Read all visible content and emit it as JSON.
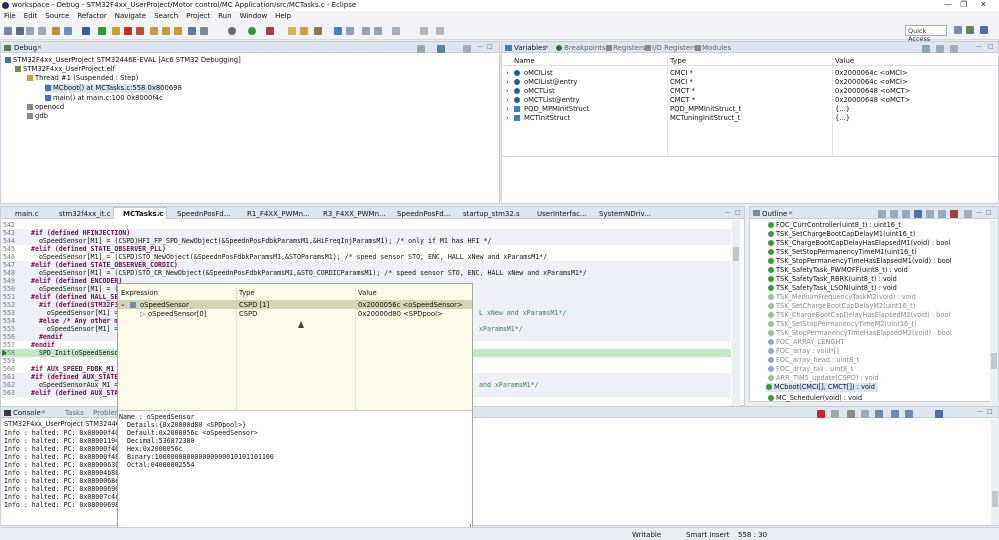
{
  "window": {
    "title": "workspace - Debug - STM32F4xx_UserProject/Motor control/MC Application/src/MCTasks.c - Eclipse"
  },
  "menu": [
    "File",
    "Edit",
    "Source",
    "Refactor",
    "Navigate",
    "Search",
    "Project",
    "Run",
    "Window",
    "Help"
  ],
  "quick_access": "Quick Access",
  "debug": {
    "tab": "Debug",
    "tree": [
      "STM32F4xx_UserProject STM32446E-EVAL [Ac6 STM32 Debugging]",
      "STM32F4xx_UserProject.elf",
      "Thread #1 (Suspended : Step)",
      "MCboot() at MCTasks.c:558 0x800698",
      "main() at main.c:100 0x8000f4c",
      "openocd",
      "gdb"
    ]
  },
  "variables": {
    "tabs": [
      "Variables",
      "Breakpoints",
      "Registers",
      "I/O Registers",
      "Modules"
    ],
    "columns": [
      "Name",
      "Type",
      "Value"
    ],
    "rows": [
      {
        "name": "oMCIList",
        "type": "CMCI *",
        "value": "0x2000064c <oMCI>"
      },
      {
        "name": "oMCIList@entry",
        "type": "CMCI *",
        "value": "0x2000064c <oMCI>"
      },
      {
        "name": "oMCTList",
        "type": "CMCT *",
        "value": "0x20000648 <oMCT>"
      },
      {
        "name": "oMCTList@entry",
        "type": "CMCT *",
        "value": "0x20000648 <oMCT>"
      },
      {
        "name": "PQD_MPMInitStruct",
        "type": "PQD_MPMInitStruct_t",
        "value": "{...}"
      },
      {
        "name": "MCTInitStruct",
        "type": "MCTuningInitStruct_t",
        "value": "{...}"
      }
    ]
  },
  "editor": {
    "tabs": [
      "main.c",
      "stm32f4xx_it.c",
      "MCTasks.c",
      "SpeednPosFd...",
      "R1_F4XX_PWMn...",
      "R3_F4XX_PWMn...",
      "SpeednPosFd...",
      "startup_stm32.s",
      "UserInterfac...",
      "SystemNDriv..."
    ],
    "lines": [
      {
        "n": "542",
        "t": ""
      },
      {
        "n": "543",
        "t": "#if (defined HFINJECTION)"
      },
      {
        "n": "544",
        "t": "  oSpeedSensor[M1] = (CSPD)HFI_FP_SPD_NewObject(&SpeednPosFdbkParamsM1,&HiFreqInjParamsM1); /* only if M1 has HFI */"
      },
      {
        "n": "545",
        "t": "#elif (defined STATE_OBSERVER_PLL)"
      },
      {
        "n": "546",
        "t": "  oSpeedSensor[M1] = (CSPD)STO_NewObject(&SpeednPosFdbkParamsM1,&STOParamsM1); /* speed sensor STO, ENC, HALL xNew and xParamsM1*/"
      },
      {
        "n": "547",
        "t": "#elif (defined STATE_OBSERVER_CORDIC)"
      },
      {
        "n": "548",
        "t": "  oSpeedSensor[M1] = (CSPD)STO_CR_NewObject(&SpeednPosFdbkParamsM1,&STO_CORDICParamsM1); /* speed sensor STO, ENC, HALL xNew and xParamsM1*/"
      },
      {
        "n": "549",
        "t": "#elif (defined ENCODER)"
      },
      {
        "n": "550",
        "t": "  oSpeedSensor[M1] = (CSP"
      },
      {
        "n": "551",
        "t": "#elif (defined HALL_SENS"
      },
      {
        "n": "552",
        "t": "  #if (defined(STM32F30X"
      },
      {
        "n": "553",
        "t": "    oSpeedSensor[M1] = ("
      },
      {
        "n": "554",
        "t": "  #else /* Any other mi"
      },
      {
        "n": "555",
        "t": "    oSpeedSensor[M1] = ("
      },
      {
        "n": "556",
        "t": "  #endif"
      },
      {
        "n": "557",
        "t": "#endif"
      },
      {
        "n": "558",
        "t": "  SPD_Init(oSpeedSensor["
      },
      {
        "n": "559",
        "t": ""
      },
      {
        "n": "560",
        "t": "#if AUX_SPEED_FDBK_M1"
      },
      {
        "n": "561",
        "t": "#if (defined AUX_STATE_O"
      },
      {
        "n": "562",
        "t": "  oSpeedSensorAux_M1 = ("
      },
      {
        "n": "563",
        "t": "#elif (defined AUX_STATE"
      }
    ],
    "right_tail": [
      {
        "line": "552",
        "t": "L xNew and xParamsM1*/"
      },
      {
        "line": "555",
        "t": "xParamsM1*/"
      },
      {
        "line": "562",
        "t": "and xParamsM1*/"
      }
    ]
  },
  "outline": {
    "tab": "Outline",
    "items": [
      "FOC_CurrController(uint8_t) : uint16_t",
      "TSK_SetChargeBootCapDelayM1(uint16_t)",
      "TSK_ChargeBootCapDelayHasElapsedM1(void) : bool",
      "TSK_SetStopPermanencyTimeM1(uint16_t)",
      "TSK_StopPermanencyTimeHasElapsedM1(void) : bool",
      "TSK_SafetyTask_PWMOFF(uint8_t) : void",
      "TSK_SafetyTask_RBRK(uint8_t) : void",
      "TSK_SafetyTask_LSON(uint8_t) : void",
      "TSK_MediumFrequencyTaskM2(void) : void",
      "TSK_SetChargeBootCapDelayM2(uint16_t)",
      "TSK_ChargeBootCapDelayHasElapsedM2(void) : bool",
      "TSK_SetStopPermanencyTimeM2(uint16_t)",
      "TSK_StopPermanencyTimeHasElapsedM2(void) : bool",
      "FOC_ARRAY_LENGHT",
      "FOC_array : void*[]",
      "FOC_array_head : uint8_t",
      "FOC_array_tail : uint8_t",
      "ARR_TIM5_update(CSPD) : void",
      "MCboot(CMCI[], CMCT[]) : void",
      "MC_Scheduler(void) : void"
    ]
  },
  "console": {
    "tabs": [
      "Console",
      "Tasks",
      "Problems"
    ],
    "header": "STM32F4xx_UserProject STM32446E-EVAL",
    "lines": [
      "Info : halted: PC: 0x08000f40",
      "Info : halted: PC: 0x08001194",
      "Info : halted: PC: 0x08000f46",
      "Info : halted: PC: 0x08000f48",
      "Info : halted: PC: 0x08000630",
      "Info : halted: PC: 0x08004b88",
      "Info : halted: PC: 0x0800068e",
      "Info : halted: PC: 0x08000690",
      "Info : halted: PC: 0x08007c4c",
      "Info : halted: PC: 0x08000698"
    ]
  },
  "hover": {
    "columns": [
      "Expression",
      "Type",
      "Value"
    ],
    "rows": [
      {
        "expr": "oSpeedSensor",
        "type": "CSPD [1]",
        "value": "0x2000056c <oSpeedSensor>"
      },
      {
        "expr": "oSpeedSensor[0]",
        "type": "CSPD",
        "value": "0x20000d80 <SPDpool>"
      }
    ],
    "details": [
      "Name : oSpeedSensor",
      "  Details:{0x20000d80 <SPDpool>}",
      "  Default:0x2000056c <oSpeedSensor>",
      "  Decimal:536872300",
      "  Hex:0x2000056c",
      "  Binary:100000000000000000010101101100",
      "  Octal:04000002554"
    ]
  },
  "status": {
    "writable": "Writable",
    "insert": "Smart Insert",
    "position": "558 : 30"
  }
}
